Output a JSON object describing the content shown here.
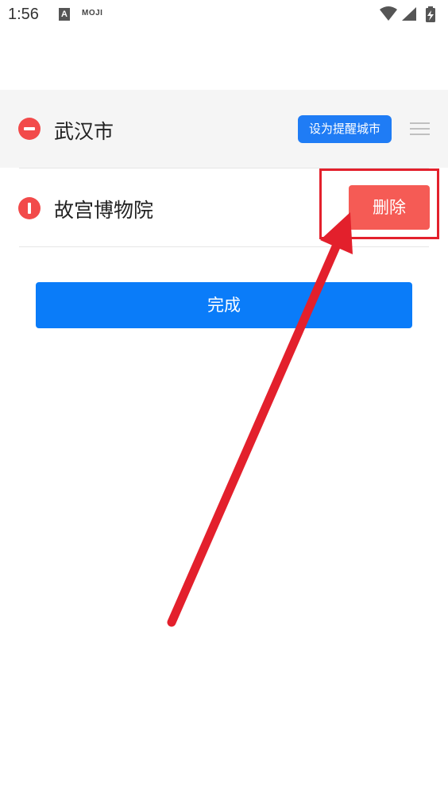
{
  "status_bar": {
    "time": "1:56",
    "notification_a": "A",
    "notification_moji": "MOJI",
    "icons": [
      "wifi-icon",
      "signal-icon",
      "battery-charging-icon"
    ]
  },
  "list": {
    "items": [
      {
        "name": "武汉市",
        "action_label": "设为提醒城市"
      },
      {
        "name": "故宫博物院",
        "action_label": "删除"
      }
    ]
  },
  "done_label": "完成",
  "colors": {
    "primary": "#0a7cf9",
    "delete": "#f55b55",
    "minus": "#f24a4a",
    "annotation": "#e3202c"
  }
}
